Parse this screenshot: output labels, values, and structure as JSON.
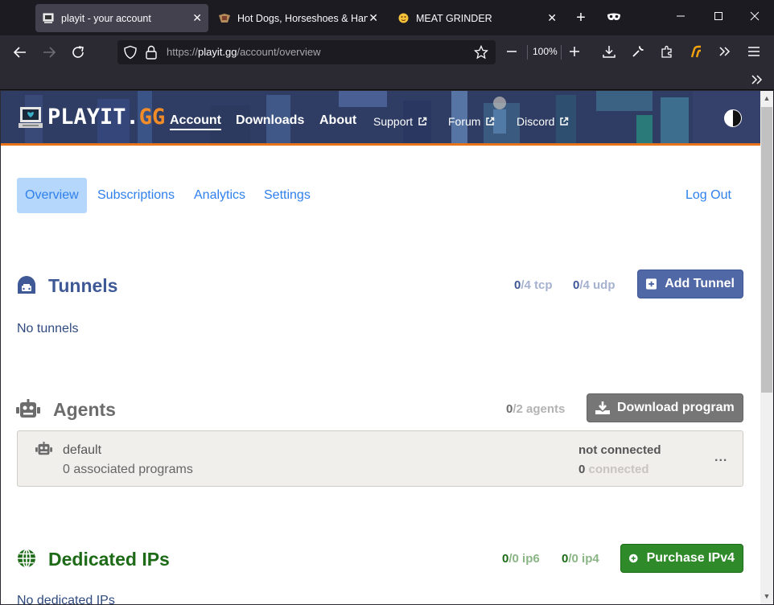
{
  "browser": {
    "tabs": [
      {
        "title": "playit - your account",
        "active": true
      },
      {
        "title": "Hot Dogs, Horseshoes & Hand",
        "active": false
      },
      {
        "title": "MEAT GRINDER",
        "active": false
      }
    ],
    "url_prefix": "https://",
    "url_domain": "playit.gg",
    "url_path": "/account/overview",
    "zoom": "100%"
  },
  "header": {
    "logo_main": "PLAYIT.",
    "logo_accent": "GG",
    "nav": {
      "account": "Account",
      "downloads": "Downloads",
      "about": "About",
      "support": "Support",
      "forum": "Forum",
      "discord": "Discord"
    }
  },
  "subnav": {
    "overview": "Overview",
    "subscriptions": "Subscriptions",
    "analytics": "Analytics",
    "settings": "Settings",
    "logout": "Log Out"
  },
  "tunnels": {
    "title": "Tunnels",
    "tcp_used": "0",
    "tcp_limit": "/4 tcp",
    "udp_used": "0",
    "udp_limit": "/4 udp",
    "add_label": "Add Tunnel",
    "empty": "No tunnels"
  },
  "agents": {
    "title": "Agents",
    "used": "0",
    "limit": "/2 agents",
    "download_label": "Download program",
    "card": {
      "name": "default",
      "programs": "0 associated programs",
      "status": "not connected",
      "connected_count": "0",
      "connected_label": " connected",
      "more": "..."
    }
  },
  "ips": {
    "title": "Dedicated IPs",
    "ip6_used": "0",
    "ip6_limit": "/0 ip6",
    "ip4_used": "0",
    "ip4_limit": "/0 ip4",
    "purchase_label": "Purchase IPv4",
    "empty": "No dedicated IPs"
  },
  "colors": {
    "tunnels": "#3f5996",
    "agents": "#6c6c6c",
    "ips": "#1d6a17",
    "link": "#2f80ed",
    "header_bg": "#2f3d64",
    "header_accent": "#e7731b"
  }
}
